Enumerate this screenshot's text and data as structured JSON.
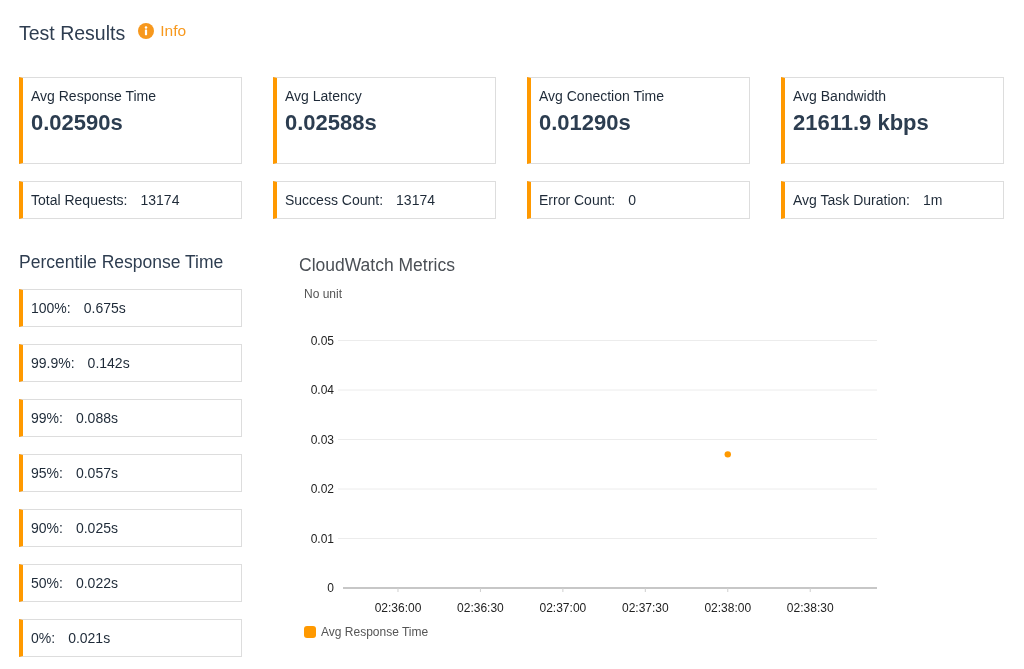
{
  "header": {
    "title": "Test Results",
    "info_link": "Info"
  },
  "summary_cards": [
    {
      "label": "Avg Response Time",
      "value": "0.02590s"
    },
    {
      "label": "Avg Latency",
      "value": "0.02588s"
    },
    {
      "label": "Avg Conection Time",
      "value": "0.01290s"
    },
    {
      "label": "Avg Bandwidth",
      "value": "21611.9 kbps"
    }
  ],
  "stat_cards": [
    {
      "label": "Total Requests:",
      "value": "13174"
    },
    {
      "label": "Success Count:",
      "value": "13174"
    },
    {
      "label": "Error Count:",
      "value": "0"
    },
    {
      "label": "Avg Task Duration:",
      "value": "1m"
    }
  ],
  "percentiles": {
    "title": "Percentile Response Time",
    "items": [
      {
        "label": "100%:",
        "value": "0.675s"
      },
      {
        "label": "99.9%:",
        "value": "0.142s"
      },
      {
        "label": "99%:",
        "value": "0.088s"
      },
      {
        "label": "95%:",
        "value": "0.057s"
      },
      {
        "label": "90%:",
        "value": "0.025s"
      },
      {
        "label": "50%:",
        "value": "0.022s"
      },
      {
        "label": "0%:",
        "value": "0.021s"
      }
    ]
  },
  "chart": {
    "chart_data": {
      "type": "scatter",
      "title": "CloudWatch Metrics",
      "ylabel": "No unit",
      "categories": [
        "02:36:00",
        "02:36:30",
        "02:37:00",
        "02:37:30",
        "02:38:00",
        "02:38:30"
      ],
      "series": [
        {
          "name": "Avg Response Time",
          "color": "#ff9900",
          "values": [
            null,
            null,
            null,
            null,
            0.027,
            null
          ]
        }
      ],
      "ylim": [
        0,
        0.05
      ],
      "yticks": [
        0.05,
        0.04,
        0.03,
        0.02,
        0.01,
        0
      ],
      "grid": true
    }
  }
}
